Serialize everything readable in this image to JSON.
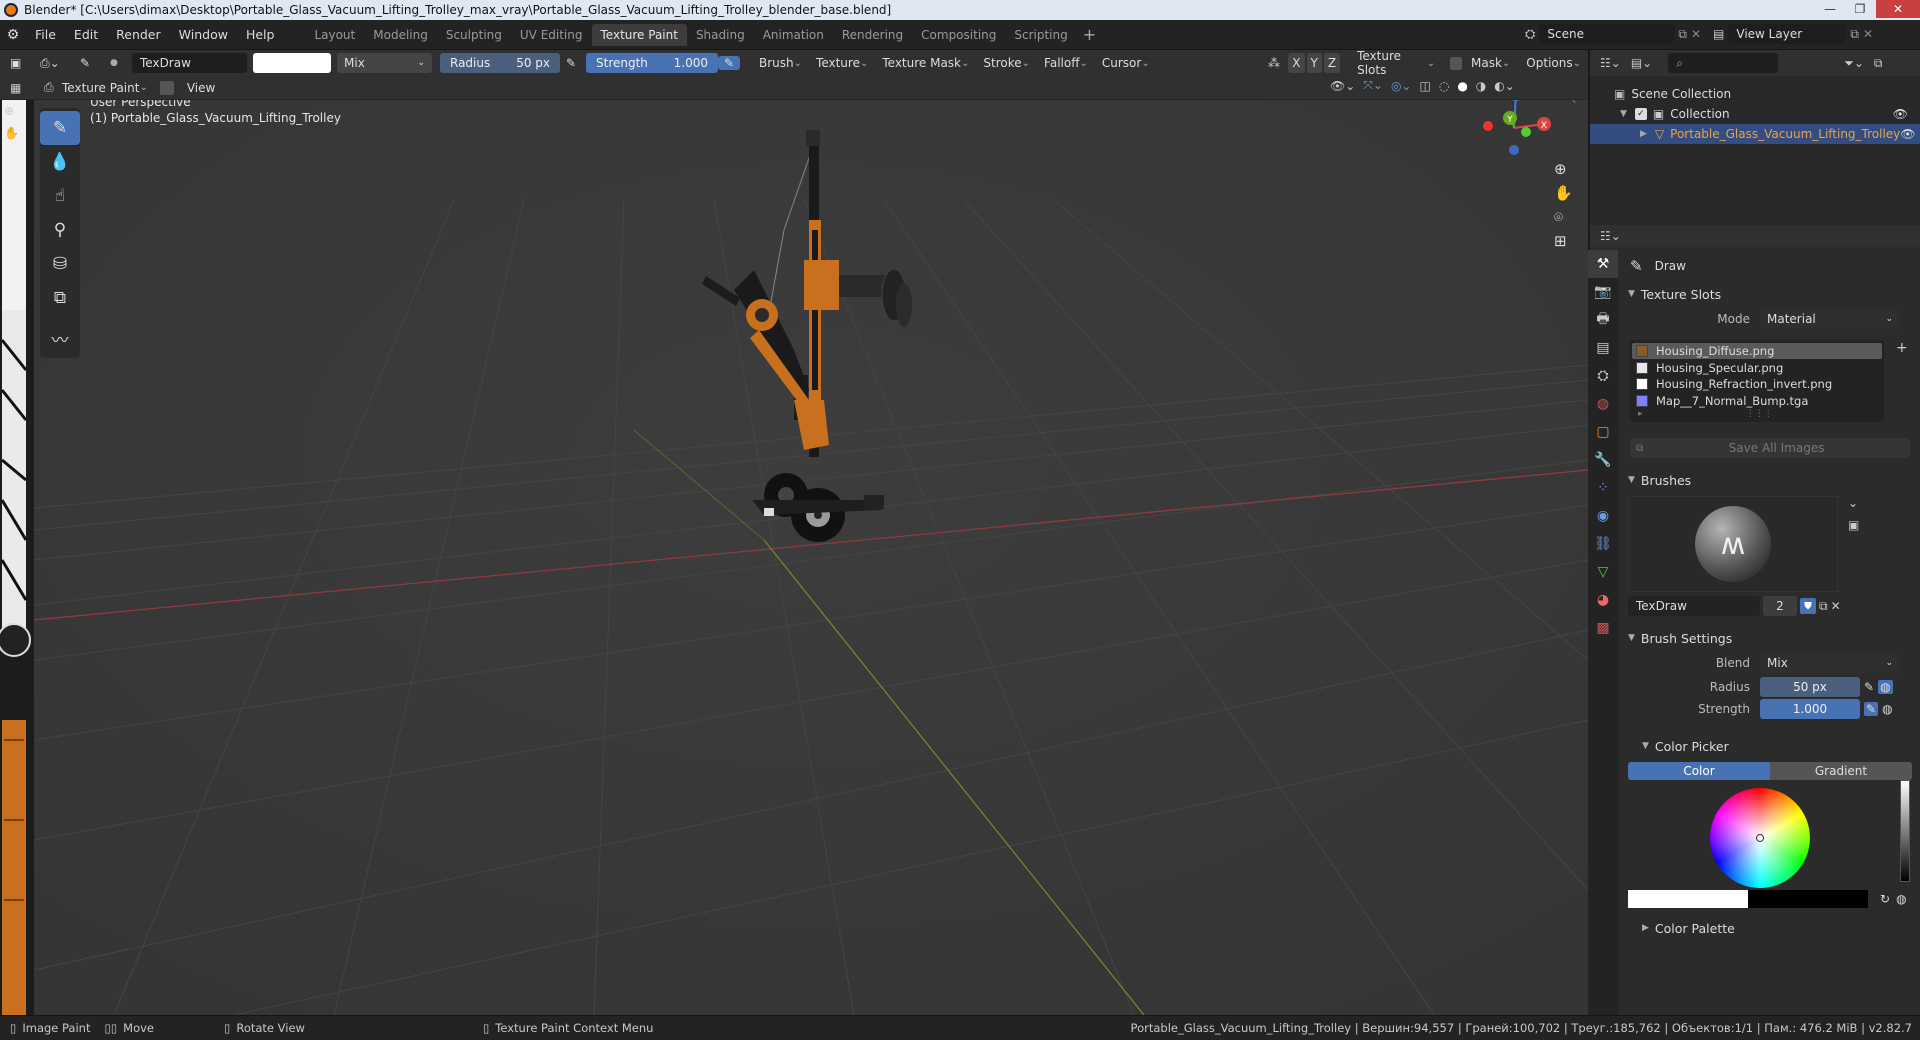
{
  "window": {
    "title": "Blender* [C:\\Users\\dimax\\Desktop\\Portable_Glass_Vacuum_Lifting_Trolley_max_vray\\Portable_Glass_Vacuum_Lifting_Trolley_blender_base.blend]"
  },
  "menu": {
    "file": "File",
    "edit": "Edit",
    "render": "Render",
    "window": "Window",
    "help": "Help"
  },
  "workspaces": [
    "Layout",
    "Modeling",
    "Sculpting",
    "UV Editing",
    "Texture Paint",
    "Shading",
    "Animation",
    "Rendering",
    "Compositing",
    "Scripting"
  ],
  "active_workspace": "Texture Paint",
  "scene": {
    "name": "Scene",
    "view_layer": "View Layer"
  },
  "toolheader": {
    "brush_name": "TexDraw",
    "blend": "Mix",
    "radius_label": "Radius",
    "radius_value": "50 px",
    "strength_label": "Strength",
    "strength_value": "1.000",
    "brush": "Brush",
    "texture": "Texture",
    "texture_mask": "Texture Mask",
    "stroke": "Stroke",
    "falloff": "Falloff",
    "cursor": "Cursor",
    "x": "X",
    "y": "Y",
    "z": "Z",
    "texture_slots": "Texture Slots",
    "mask": "Mask",
    "options": "Options"
  },
  "viewheader": {
    "mode": "Texture Paint",
    "view": "View"
  },
  "viewport": {
    "perspective": "User Perspective",
    "object_label": "(1) Portable_Glass_Vacuum_Lifting_Trolley",
    "gizmo": {
      "z": "Z",
      "y": "Y",
      "x": "X"
    }
  },
  "outliner": {
    "scene_collection": "Scene Collection",
    "collection": "Collection",
    "object": "Portable_Glass_Vacuum_Lifting_Trolley"
  },
  "properties": {
    "tool_name": "Draw",
    "texture_slots": {
      "title": "Texture Slots",
      "mode_label": "Mode",
      "mode_value": "Material",
      "slots": [
        "Housing_Diffuse.png",
        "Housing_Specular.png",
        "Housing_Refraction_invert.png",
        "Map__7_Normal_Bump.tga"
      ],
      "save_all": "Save All Images"
    },
    "brushes": {
      "title": "Brushes",
      "brush_name": "TexDraw",
      "users": "2"
    },
    "brush_settings": {
      "title": "Brush Settings",
      "blend_label": "Blend",
      "blend_value": "Mix",
      "radius_label": "Radius",
      "radius_value": "50 px",
      "strength_label": "Strength",
      "strength_value": "1.000"
    },
    "color_picker": {
      "title": "Color Picker",
      "color_tab": "Color",
      "gradient_tab": "Gradient"
    },
    "color_palette": {
      "title": "Color Palette"
    }
  },
  "statusbar": {
    "image_paint": "Image Paint",
    "move": "Move",
    "rotate_view": "Rotate View",
    "context_menu": "Texture Paint Context Menu",
    "stats": "Portable_Glass_Vacuum_Lifting_Trolley | Вершин:94,557 | Граней:100,702 | Треуг.:185,762 | Объектов:1/1 | Пам.: 476.2 MiB | v2.82.7"
  },
  "colors": {
    "accent_blue": "#4772b3",
    "selected_object": "#e8a24a",
    "trolley_orange": "#c8701e"
  }
}
